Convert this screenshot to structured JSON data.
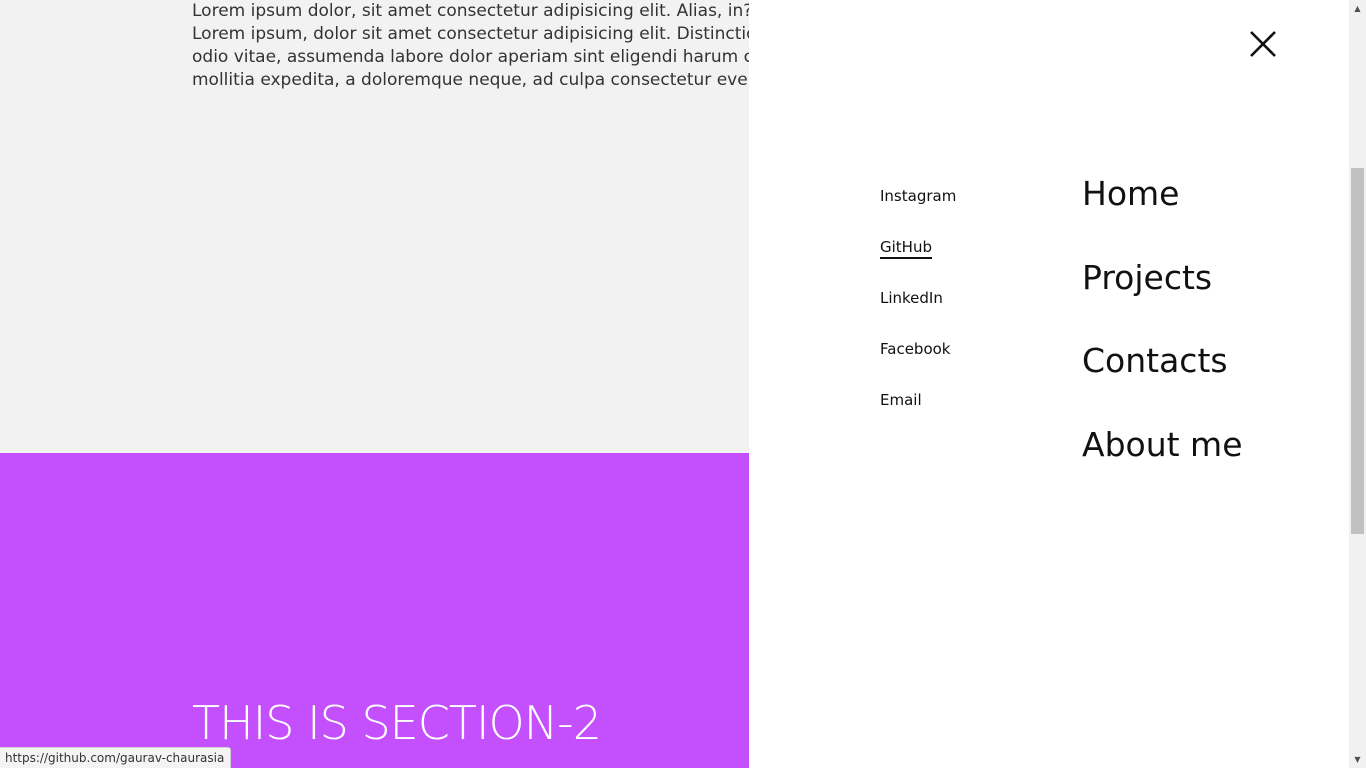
{
  "content": {
    "lorem_lines": [
      "Lorem ipsum dolor, sit amet consectetur adipisicing elit. Alias, in?",
      "Lorem ipsum, dolor sit amet consectetur adipisicing elit. Distinctio, ma",
      "odio vitae, assumenda labore dolor aperiam sint eligendi harum conse",
      "mollitia expedita, a doloremque neque, ad culpa consectetur eveniet a"
    ],
    "section_2_title": "THIS IS SECTION-2",
    "section_2_color": "#c44ffd"
  },
  "menu": {
    "close_icon": "close-icon",
    "social_links": [
      {
        "label": "Instagram",
        "active": false
      },
      {
        "label": "GitHub",
        "active": true
      },
      {
        "label": "LinkedIn",
        "active": false
      },
      {
        "label": "Facebook",
        "active": false
      },
      {
        "label": "Email",
        "active": false
      }
    ],
    "nav_links": [
      "Home",
      "Projects",
      "Contacts",
      "About me"
    ]
  },
  "status_bar": {
    "url": "https://github.com/gaurav-chaurasia"
  }
}
